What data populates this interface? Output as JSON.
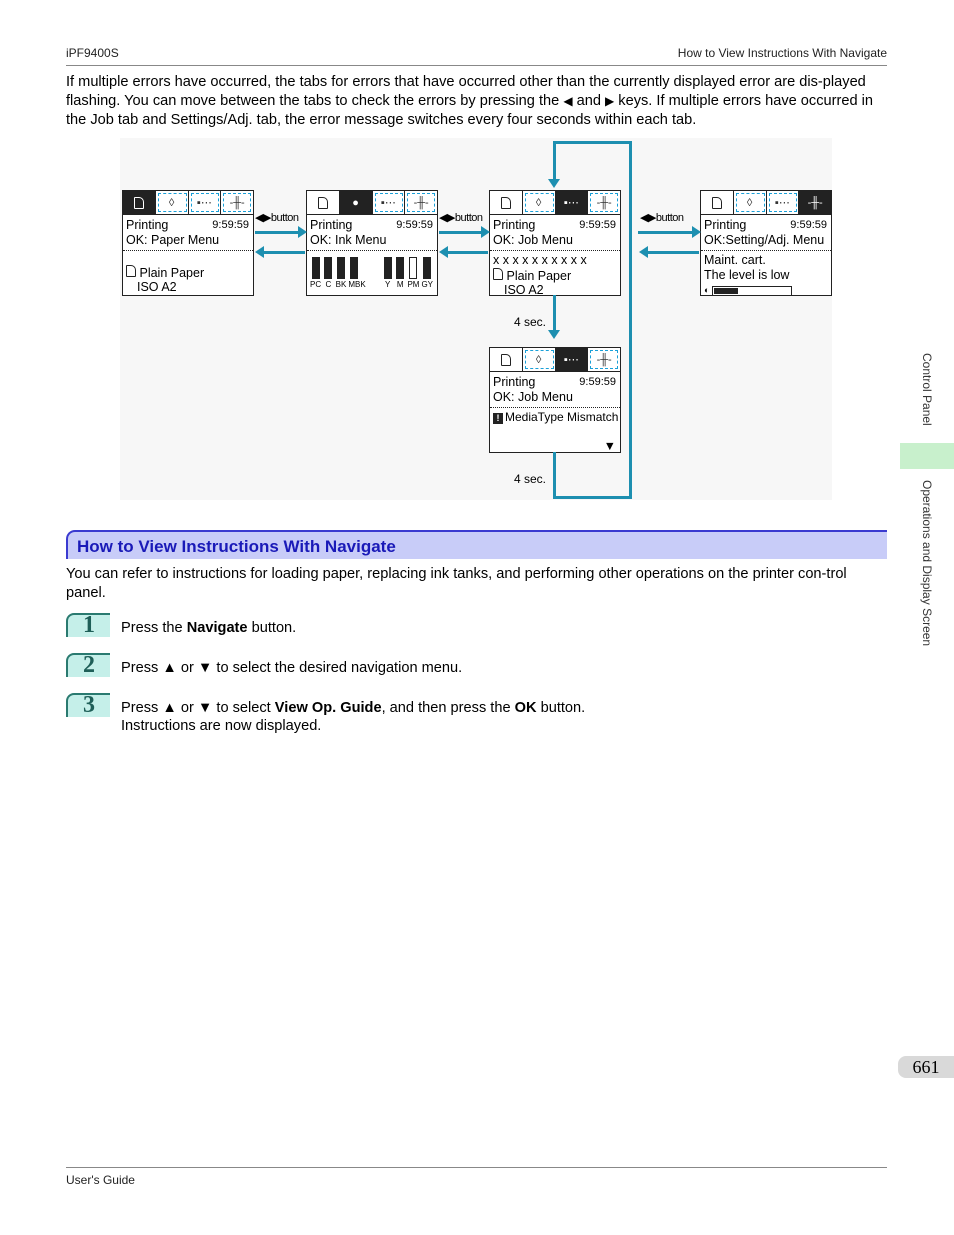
{
  "header": {
    "model": "iPF9400S",
    "section_title": "How to View Instructions With Navigate"
  },
  "intro": {
    "part1": "If multiple errors have occurred, the tabs for errors that have occurred other than the currently displayed error are dis-played flashing. You can move between the tabs to check the errors by pressing the ",
    "left_key": "◀",
    "and": " and ",
    "right_key": "▶",
    "part2": " keys. If multiple errors have occurred in the Job tab and Settings/Adj. tab, the error message switches every four seconds within each tab."
  },
  "diagram": {
    "button_label": "◀▶button",
    "interval_label": "4 sec.",
    "screens": [
      {
        "status": "Printing",
        "time": "9:59:59",
        "menu": "OK: Paper Menu",
        "line1": "",
        "paper_type": "Plain Paper",
        "paper_size": "ISO A2"
      },
      {
        "status": "Printing",
        "time": "9:59:59",
        "menu": "OK: Ink Menu",
        "inks": [
          "PC",
          "C",
          "BK",
          "MBK",
          "Y",
          "M",
          "PM",
          "GY"
        ]
      },
      {
        "status": "Printing",
        "time": "9:59:59",
        "menu": "OK: Job Menu",
        "line1": "x x x x x x x x x x",
        "paper_type": "Plain Paper",
        "paper_size": "ISO A2"
      },
      {
        "status": "Printing",
        "time": "9:59:59",
        "menu": "OK:Setting/Adj. Menu",
        "line1": "Maint. cart.",
        "line2": "The level is low",
        "level_fraction": 0.3
      },
      {
        "status": "Printing",
        "time": "9:59:59",
        "menu": "OK: Job Menu",
        "error": "MediaType Mismatch",
        "scroll": "▼"
      }
    ]
  },
  "section": {
    "title": "How to View Instructions With Navigate",
    "body": "You can refer to instructions for loading paper, replacing ink tanks, and performing other operations on the printer con-trol panel."
  },
  "steps": [
    {
      "num": "1",
      "pre": "Press the ",
      "bold": "Navigate",
      "post": " button."
    },
    {
      "num": "2",
      "text": "Press ▲ or ▼ to select the desired navigation menu."
    },
    {
      "num": "3",
      "pre": "Press ▲ or ▼ to select ",
      "bold": "View Op. Guide",
      "mid": ", and then press the ",
      "bold2": "OK",
      "post": " button.",
      "line2": "Instructions are now displayed."
    }
  ],
  "side_tabs": {
    "chapter": "Control Panel",
    "section": "Operations and Display Screen"
  },
  "page_number": "661",
  "footer": {
    "title": "User's Guide"
  }
}
